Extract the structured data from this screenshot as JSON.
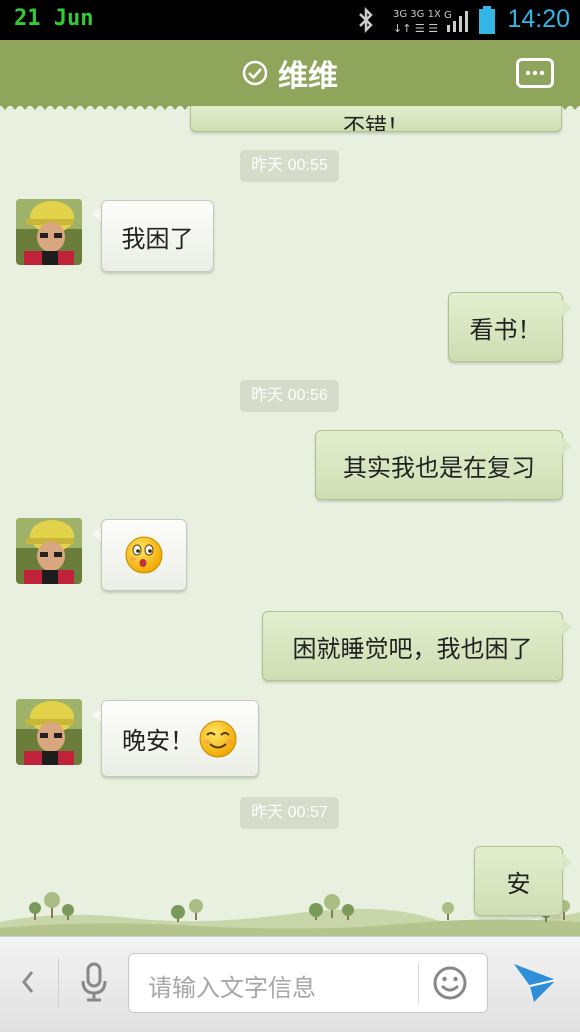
{
  "status_bar": {
    "date": "21 Jun",
    "time": "14:20",
    "icons": [
      "bluetooth-icon",
      "network-3g-icon",
      "signal-icon",
      "battery-icon"
    ]
  },
  "header": {
    "title": "维维",
    "left_icon": "check-circle-icon",
    "right_icon": "more-options-icon"
  },
  "chat": {
    "partial_top_text": "不错！",
    "timestamps": [
      "昨天 00:55",
      "昨天 00:56",
      "昨天 00:57"
    ],
    "messages": [
      {
        "side": "in",
        "text": "我困了"
      },
      {
        "side": "out",
        "text": "看书！"
      },
      {
        "side": "out",
        "text": "其实我也是在复习"
      },
      {
        "side": "in",
        "text": "",
        "emoji": "surprised-emoji-icon"
      },
      {
        "side": "out",
        "text": "困就睡觉吧，我也困了"
      },
      {
        "side": "in",
        "text": "晚安！",
        "emoji": "smile-emoji-icon"
      },
      {
        "side": "out",
        "text": "安"
      }
    ]
  },
  "input_bar": {
    "placeholder": "请输入文字信息",
    "icons": [
      "back-chevron-icon",
      "microphone-icon",
      "emoji-icon",
      "send-icon"
    ]
  },
  "colors": {
    "header": "#8fa55c",
    "background": "#e9f0df",
    "outgoing_bubble": "#d4e1bb",
    "incoming_bubble": "#f8f8f5",
    "time": "#33b5e5"
  }
}
